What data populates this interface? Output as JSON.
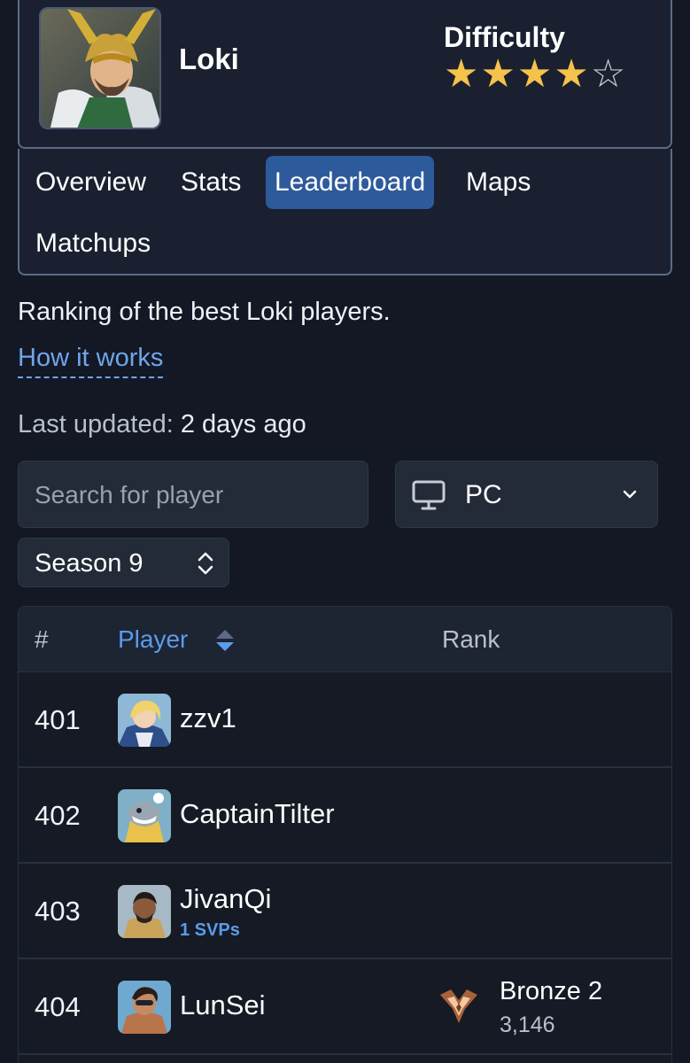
{
  "hero": {
    "name": "Loki",
    "portrait_icon": "loki-portrait",
    "difficulty_label": "Difficulty",
    "difficulty_stars_filled": 4,
    "difficulty_stars_total": 5
  },
  "tabs": [
    {
      "label": "Overview",
      "active": false
    },
    {
      "label": "Stats",
      "active": false
    },
    {
      "label": "Leaderboard",
      "active": true
    },
    {
      "label": "Maps",
      "active": false
    },
    {
      "label": "Matchups",
      "active": false
    }
  ],
  "description": "Ranking of the best Loki players.",
  "how_it_works": "How it works",
  "last_updated": {
    "label": "Last updated:",
    "value": "2 days ago"
  },
  "filters": {
    "search_placeholder": "Search for player",
    "platform": "PC",
    "season": "Season 9"
  },
  "table": {
    "headers": {
      "num": "#",
      "player": "Player",
      "rank": "Rank"
    },
    "rows": [
      {
        "pos": "401",
        "name": "zzv1",
        "svps": "",
        "rank_name": "",
        "rank_score": ""
      },
      {
        "pos": "402",
        "name": "CaptainTilter",
        "svps": "",
        "rank_name": "",
        "rank_score": ""
      },
      {
        "pos": "403",
        "name": "JivanQi",
        "svps": "1 SVPs",
        "rank_name": "",
        "rank_score": ""
      },
      {
        "pos": "404",
        "name": "LunSei",
        "svps": "",
        "rank_name": "Bronze 2",
        "rank_score": "3,146"
      }
    ]
  },
  "colors": {
    "accent": "#2d5a9b",
    "link": "#6fa6ea",
    "star": "#f5c24a",
    "background": "#131824"
  }
}
